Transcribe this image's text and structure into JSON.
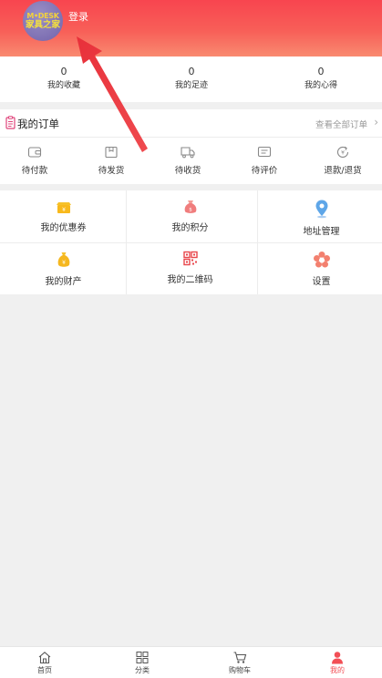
{
  "header": {
    "avatar": {
      "line1": "M•DESK",
      "line2": "家具之家"
    },
    "login_label": "登录",
    "accent": "#f8454f"
  },
  "stats": [
    {
      "count": "0",
      "label": "我的收藏"
    },
    {
      "count": "0",
      "label": "我的足迹"
    },
    {
      "count": "0",
      "label": "我的心得"
    }
  ],
  "orders": {
    "title": "我的订单",
    "view_all": "查看全部订单",
    "items": [
      {
        "label": "待付款",
        "icon": "wallet-icon"
      },
      {
        "label": "待发货",
        "icon": "box-icon"
      },
      {
        "label": "待收货",
        "icon": "truck-icon"
      },
      {
        "label": "待评价",
        "icon": "comment-icon"
      },
      {
        "label": "退款/退货",
        "icon": "refund-icon"
      }
    ]
  },
  "services": [
    {
      "label": "我的优惠券",
      "icon": "coupon-icon"
    },
    {
      "label": "我的积分",
      "icon": "points-bag-icon"
    },
    {
      "label": "地址管理",
      "icon": "location-pin-icon"
    },
    {
      "label": "我的财产",
      "icon": "money-bag-icon"
    },
    {
      "label": "我的二维码",
      "icon": "qr-code-icon"
    },
    {
      "label": "设置",
      "icon": "flower-settings-icon"
    }
  ],
  "tabbar": {
    "items": [
      {
        "label": "首页",
        "icon": "home-icon"
      },
      {
        "label": "分类",
        "icon": "category-icon"
      },
      {
        "label": "购物车",
        "icon": "cart-icon"
      },
      {
        "label": "我的",
        "icon": "user-icon"
      }
    ],
    "active": "我的",
    "active_color": "#f24f56"
  }
}
